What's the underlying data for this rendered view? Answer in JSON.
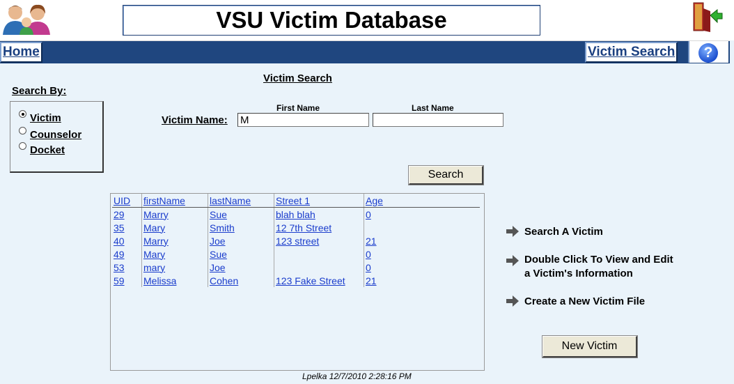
{
  "header": {
    "title": "VSU Victim Database"
  },
  "nav": {
    "home": "Home",
    "victim_search": "Victim Search",
    "help": "?"
  },
  "search_by": {
    "label": "Search By:",
    "options": [
      {
        "label": "Victim",
        "selected": true
      },
      {
        "label": "Counselor",
        "selected": false
      },
      {
        "label": "Docket",
        "selected": false
      }
    ]
  },
  "search": {
    "title": "Victim Search",
    "name_label": "Victim Name:",
    "first_name_header": "First Name",
    "last_name_header": "Last Name",
    "first_name_value": "M",
    "last_name_value": "",
    "button": "Search"
  },
  "results": {
    "columns": [
      "UID",
      "firstName",
      "lastName",
      "Street 1",
      "Age"
    ],
    "rows": [
      {
        "uid": "29",
        "first": "Marry",
        "last": "Sue",
        "street": "blah blah",
        "age": "0"
      },
      {
        "uid": "35",
        "first": "Mary",
        "last": "Smith",
        "street": "12 7th Street",
        "age": ""
      },
      {
        "uid": "40",
        "first": "Marry",
        "last": "Joe",
        "street": "123 street",
        "age": "21"
      },
      {
        "uid": "49",
        "first": "Mary",
        "last": "Sue",
        "street": "",
        "age": "0"
      },
      {
        "uid": "53",
        "first": "mary",
        "last": "Joe",
        "street": "",
        "age": "0"
      },
      {
        "uid": "59",
        "first": "Melissa",
        "last": "Cohen",
        "street": "123 Fake Street",
        "age": "21"
      }
    ]
  },
  "help_items": {
    "search": "Search A Victim",
    "double_click_1": "Double Click To View and Edit",
    "double_click_2": "a Victim's Information",
    "create": "Create a New Victim File"
  },
  "new_victim_button": "New Victim",
  "footer": "Lpelka 12/7/2010 2:28:16 PM",
  "colors": {
    "nav_bar": "#1f467f",
    "background": "#eaf3fa",
    "link": "#1a3ccc"
  }
}
